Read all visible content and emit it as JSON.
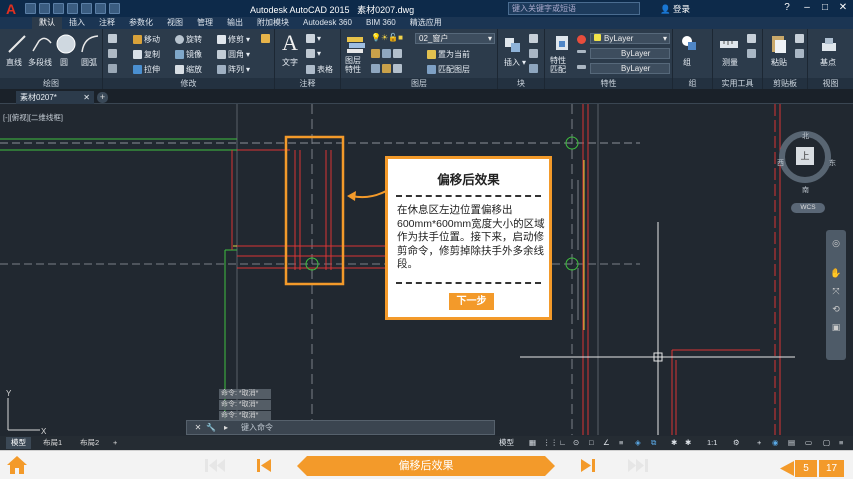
{
  "titlebar": {
    "app_title": "Autodesk AutoCAD 2015",
    "file_name": "素材0207.dwg",
    "search_placeholder": "键入关键字或短语",
    "login_label": "登录"
  },
  "ribbon_tabs": [
    "默认",
    "插入",
    "注释",
    "参数化",
    "视图",
    "管理",
    "输出",
    "附加模块",
    "Autodesk 360",
    "BIM 360",
    "精选应用"
  ],
  "active_ribbon_tab": "默认",
  "panels": {
    "draw": {
      "label": "绘图",
      "line": "直线",
      "polyline": "多段线",
      "circle": "圆",
      "arc": "圆弧"
    },
    "modify": {
      "label": "修改",
      "move": "移动",
      "rotate": "旋转",
      "trim": "修剪",
      "copy": "复制",
      "mirror": "镜像",
      "fillet": "圆角",
      "stretch": "拉伸",
      "scale": "缩放",
      "array": "阵列"
    },
    "annotation": {
      "label": "注释",
      "text": "文字",
      "table": "表格"
    },
    "layers": {
      "label": "图层",
      "layer_props": "图层特性",
      "current_layer": "02_窗户",
      "make_current": "置为当前",
      "match_layer": "匹配图层"
    },
    "block": {
      "label": "块",
      "insert": "插入"
    },
    "properties": {
      "label": "特性",
      "match": "特性匹配",
      "color": "ByLayer",
      "linetype": "ByLayer",
      "lineweight": "ByLayer"
    },
    "groups": {
      "label": "组",
      "group": "组"
    },
    "utilities": {
      "label": "实用工具",
      "measure": "测量"
    },
    "clipboard": {
      "label": "剪贴板",
      "paste": "粘贴"
    },
    "view": {
      "label": "视图",
      "base": "基点"
    }
  },
  "document_tab": "素材0207*",
  "viewport_control": "[-][俯视][二维线框]",
  "viewcube": {
    "north": "北",
    "south": "南",
    "east": "东",
    "west": "西",
    "top": "上",
    "wcs": "WCS"
  },
  "callout": {
    "title": "偏移后效果",
    "body": "在休息区左边位置偏移出600mm*600mm宽度大小的区域作为扶手位置。接下来，启动修剪命令，修剪掉除扶手外多余线段。",
    "next_button": "下一步"
  },
  "command_history": [
    "命令: *取消*",
    "命令: *取消*",
    "命令: *取消*"
  ],
  "command_placeholder": "键入命令",
  "layout_tabs": [
    "模型",
    "布局1",
    "布局2"
  ],
  "status": {
    "model": "模型",
    "scale": "1:1"
  },
  "player": {
    "chapter_title": "偏移后效果",
    "current_page": "5",
    "total_pages": "17"
  },
  "colors": {
    "accent": "#f39a2a",
    "canvas": "#212830",
    "ribbon": "#2c3b4b"
  }
}
